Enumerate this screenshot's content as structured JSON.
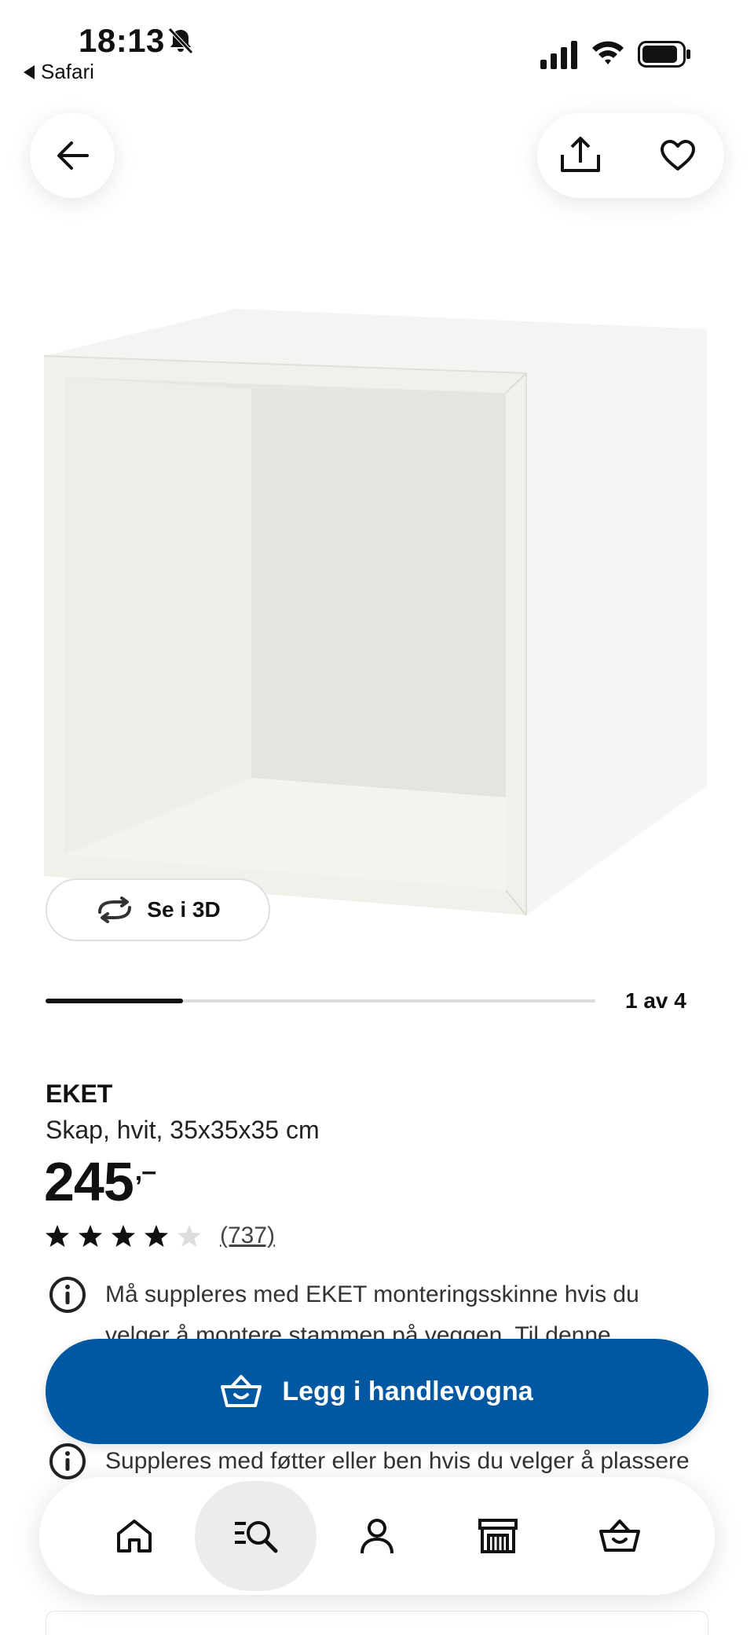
{
  "status_bar": {
    "time": "18:13",
    "back_app": "Safari"
  },
  "top_actions": {
    "back_icon": "arrow-left-icon",
    "share_icon": "share-icon",
    "favorite_icon": "heart-icon"
  },
  "gallery": {
    "see_3d_label": "Se i 3D",
    "pager_label": "1 av 4",
    "pager_progress": 0.25
  },
  "product": {
    "name": "EKET",
    "description": "Skap, hvit, 35x35x35 cm",
    "price": "245",
    "price_suffix": ",–",
    "rating_stars": 4,
    "rating_max": 5,
    "review_count": "(737)"
  },
  "info": [
    {
      "icon": "info-icon",
      "text": "Må suppleres med EKET monteringsskinne hvis du velger å montere stammen på veggen. Til denne"
    },
    {
      "icon": "info-icon",
      "text": "Suppleres med føtter eller ben hvis du velger å plassere stammen på gulvet. Selges separat."
    }
  ],
  "cart_button": {
    "label": "Legg i handlevogna",
    "icon": "basket-icon",
    "color": "#0058a3"
  },
  "bottom_nav": [
    {
      "name": "home",
      "icon": "home-icon",
      "active": false
    },
    {
      "name": "search",
      "icon": "search-list-icon",
      "active": true
    },
    {
      "name": "profile",
      "icon": "person-icon",
      "active": false
    },
    {
      "name": "store",
      "icon": "store-icon",
      "active": false
    },
    {
      "name": "cart",
      "icon": "basket-icon",
      "active": false
    }
  ]
}
